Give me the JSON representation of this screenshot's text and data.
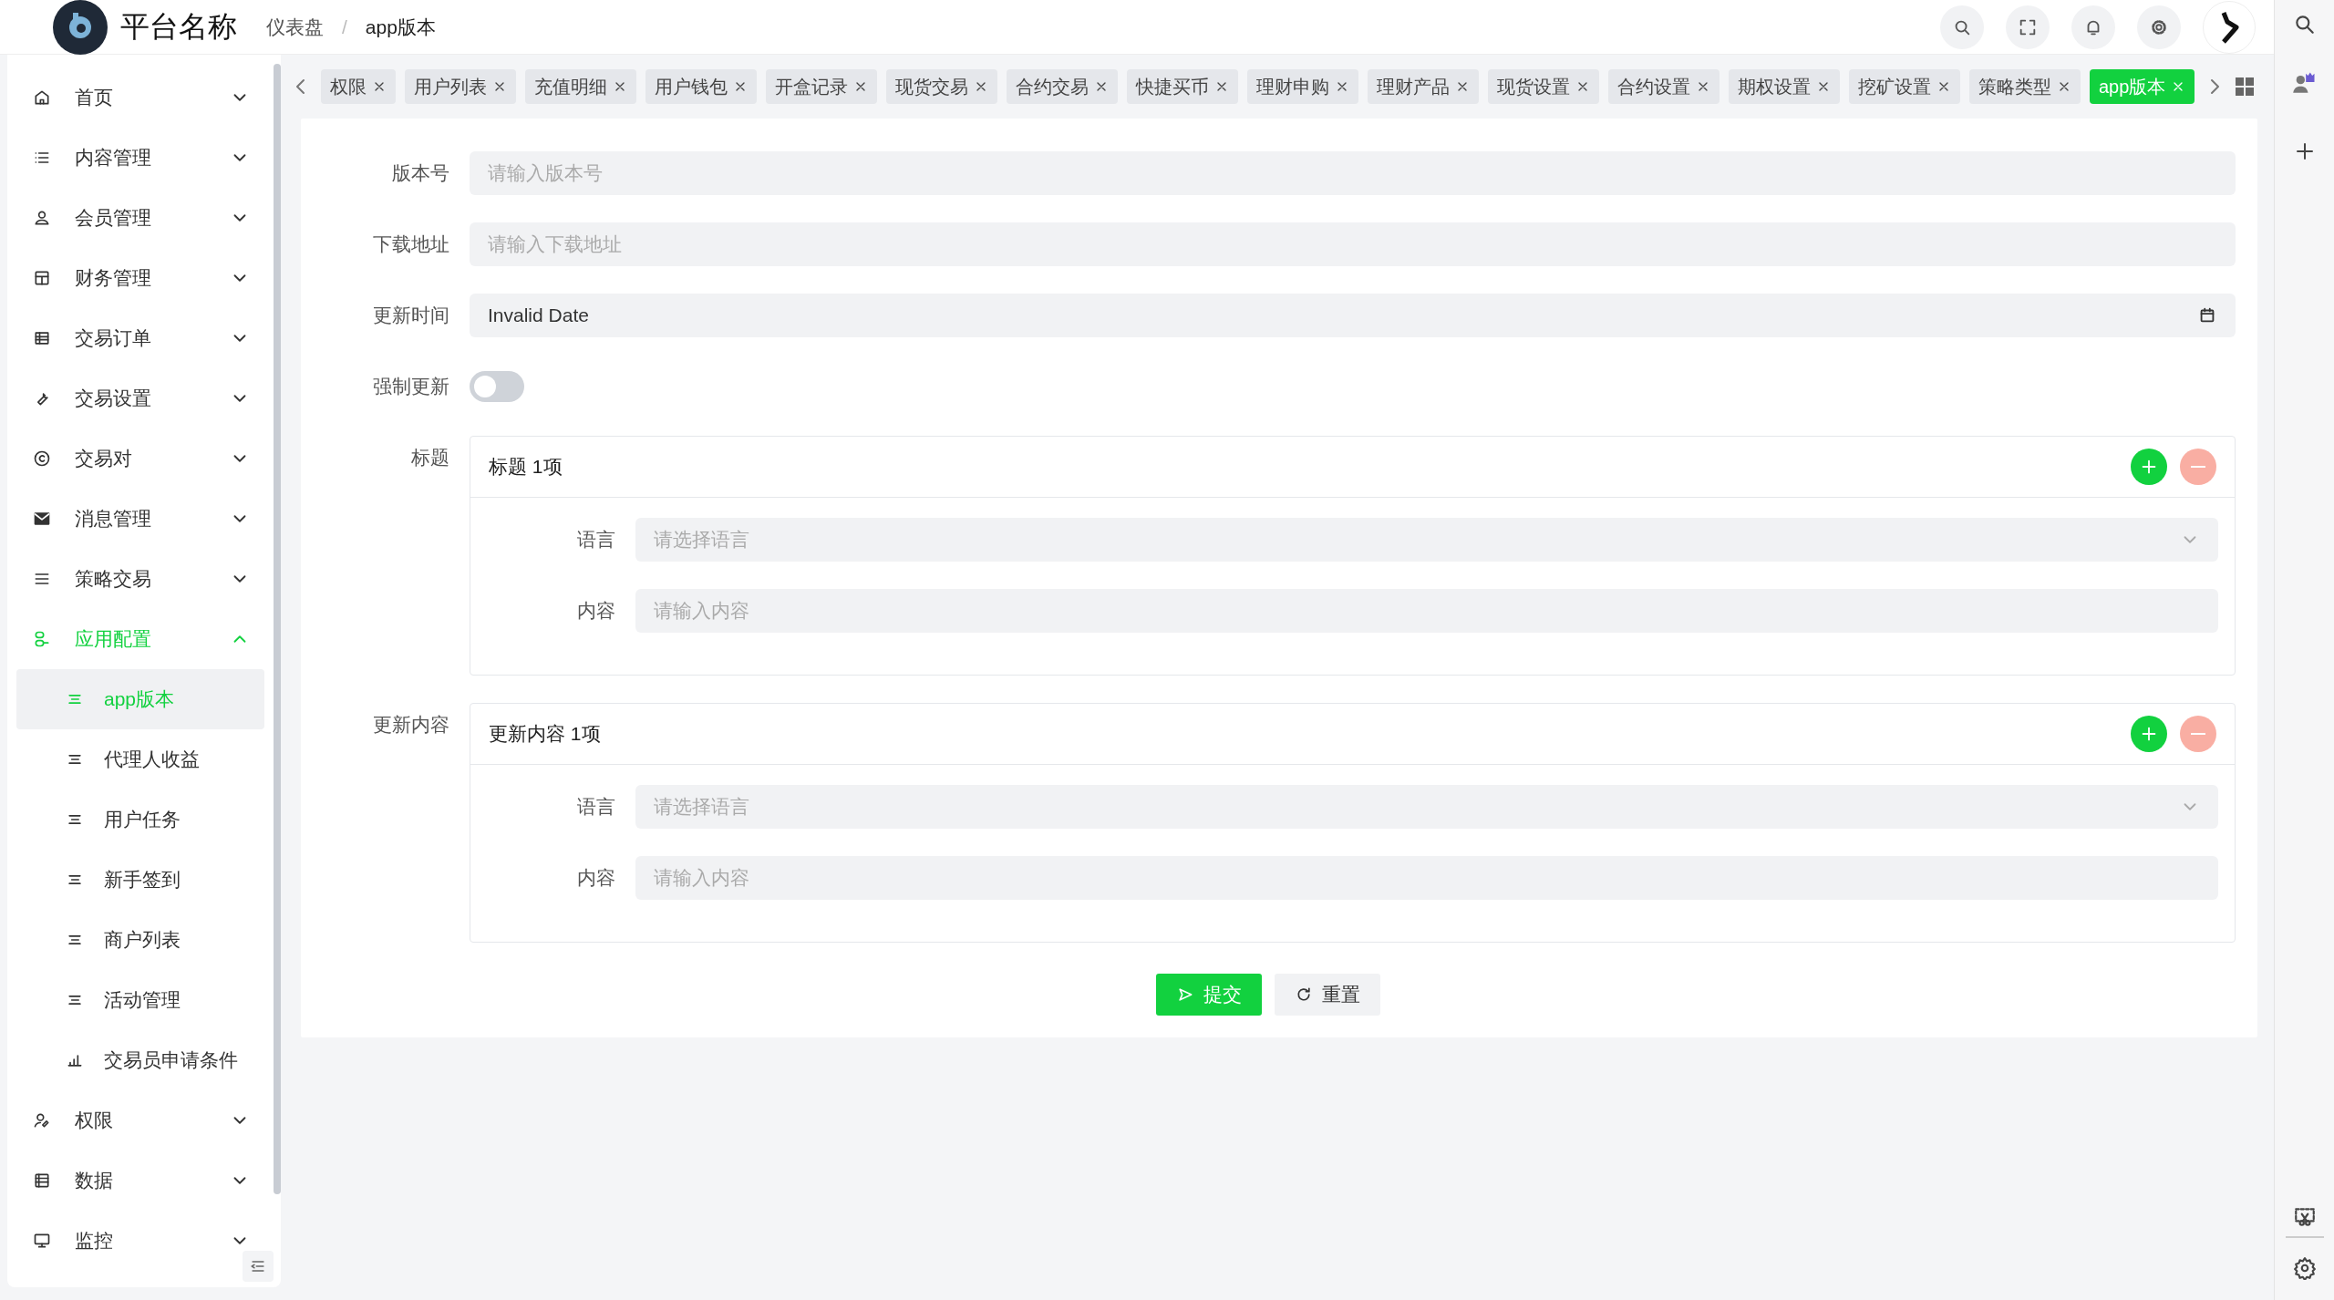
{
  "header": {
    "platform_name": "平台名称",
    "separator": "/",
    "breadcrumb": [
      {
        "label": "仪表盘",
        "current": false
      },
      {
        "label": "app版本",
        "current": true
      }
    ]
  },
  "tabs": [
    {
      "label": "权限",
      "selected": false
    },
    {
      "label": "用户列表",
      "selected": false
    },
    {
      "label": "充值明细",
      "selected": false
    },
    {
      "label": "用户钱包",
      "selected": false
    },
    {
      "label": "开盒记录",
      "selected": false
    },
    {
      "label": "现货交易",
      "selected": false
    },
    {
      "label": "合约交易",
      "selected": false
    },
    {
      "label": "快捷买币",
      "selected": false
    },
    {
      "label": "理财申购",
      "selected": false
    },
    {
      "label": "理财产品",
      "selected": false
    },
    {
      "label": "现货设置",
      "selected": false
    },
    {
      "label": "合约设置",
      "selected": false
    },
    {
      "label": "期权设置",
      "selected": false
    },
    {
      "label": "挖矿设置",
      "selected": false
    },
    {
      "label": "策略类型",
      "selected": false
    },
    {
      "label": "app版本",
      "selected": true
    }
  ],
  "sidebar": {
    "items": [
      {
        "label": "首页",
        "expanded": false
      },
      {
        "label": "内容管理",
        "expanded": false
      },
      {
        "label": "会员管理",
        "expanded": false
      },
      {
        "label": "财务管理",
        "expanded": false
      },
      {
        "label": "交易订单",
        "expanded": false
      },
      {
        "label": "交易设置",
        "expanded": false
      },
      {
        "label": "交易对",
        "expanded": false
      },
      {
        "label": "消息管理",
        "expanded": false
      },
      {
        "label": "策略交易",
        "expanded": false
      },
      {
        "label": "应用配置",
        "expanded": true,
        "children": [
          {
            "label": "app版本",
            "selected": true
          },
          {
            "label": "代理人收益",
            "selected": false
          },
          {
            "label": "用户任务",
            "selected": false
          },
          {
            "label": "新手签到",
            "selected": false
          },
          {
            "label": "商户列表",
            "selected": false
          },
          {
            "label": "活动管理",
            "selected": false
          },
          {
            "label": "交易员申请条件",
            "selected": false
          }
        ]
      },
      {
        "label": "权限",
        "expanded": false
      },
      {
        "label": "数据",
        "expanded": false
      },
      {
        "label": "监控",
        "expanded": false
      }
    ]
  },
  "form": {
    "fields": [
      {
        "kind": "input",
        "label": "版本号",
        "placeholder": "请输入版本号"
      },
      {
        "kind": "input",
        "label": "下载地址",
        "placeholder": "请输入下载地址"
      },
      {
        "kind": "date",
        "label": "更新时间",
        "value": "Invalid Date"
      },
      {
        "kind": "switch",
        "label": "强制更新",
        "on": false
      },
      {
        "kind": "group",
        "label": "标题",
        "title": "标题 1项",
        "rows": [
          {
            "kind": "select",
            "label": "语言",
            "placeholder": "请选择语言"
          },
          {
            "kind": "input",
            "label": "内容",
            "placeholder": "请输入内容"
          }
        ]
      },
      {
        "kind": "group",
        "label": "更新内容",
        "title": "更新内容 1项",
        "rows": [
          {
            "kind": "select",
            "label": "语言",
            "placeholder": "请选择语言"
          },
          {
            "kind": "input",
            "label": "内容",
            "placeholder": "请输入内容"
          }
        ]
      }
    ],
    "buttons": [
      {
        "kind": "primary",
        "label": "提交"
      },
      {
        "kind": "default",
        "label": "重置"
      }
    ]
  }
}
